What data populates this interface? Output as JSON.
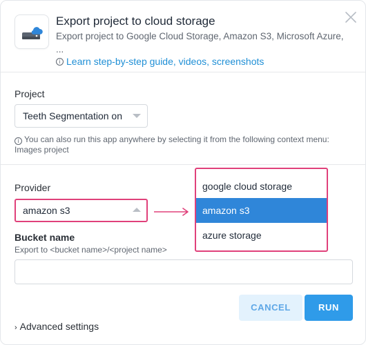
{
  "header": {
    "title": "Export project to cloud storage",
    "subtitle": "Export project to Google Cloud Storage, Amazon S3, Microsoft Azure, ...",
    "guide_link": "Learn step-by-step guide, videos, screenshots",
    "app_icon": "cloud-drive-icon",
    "close_icon": "close-icon"
  },
  "project": {
    "label": "Project",
    "selected": "Teeth Segmentation on",
    "hint": "You can also run this app anywhere by selecting it from the following context menu: Images project"
  },
  "provider": {
    "label": "Provider",
    "selected": "amazon s3",
    "options": [
      "google cloud storage",
      "amazon s3",
      "azure storage"
    ]
  },
  "bucket": {
    "label": "Bucket name",
    "hint": "Export to <bucket name>/<project name>",
    "value": "",
    "placeholder": ""
  },
  "footer": {
    "cancel_label": "CANCEL",
    "run_label": "RUN",
    "advanced_label": "Advanced settings"
  },
  "colors": {
    "accent": "#2f9be9",
    "highlight": "#e0407a",
    "selected_option": "#2f86d9"
  }
}
